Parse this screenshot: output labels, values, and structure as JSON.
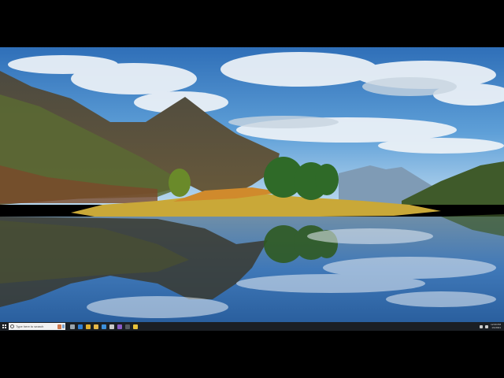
{
  "wallpaper": {
    "description_free": true
  },
  "taskbar": {
    "search_placeholder": "Type here to search",
    "pinned_apps": [
      {
        "icon": "task-view-icon",
        "color": "#9aa4ad"
      },
      {
        "icon": "edge-icon",
        "color": "#2f7fd6"
      },
      {
        "icon": "chrome-icon",
        "color": "#e0b030"
      },
      {
        "icon": "file-explorer-icon",
        "color": "#e6b84a"
      },
      {
        "icon": "store-icon",
        "color": "#3d8fd9"
      },
      {
        "icon": "settings-icon",
        "color": "#c9c9c9"
      },
      {
        "icon": "visual-studio-icon",
        "color": "#8a5cc6"
      },
      {
        "icon": "terminal-icon",
        "color": "#555a60"
      },
      {
        "icon": "notes-icon",
        "color": "#e8c23a"
      }
    ],
    "clock_time": "12:00 PM",
    "clock_date": "1/1/2021"
  }
}
